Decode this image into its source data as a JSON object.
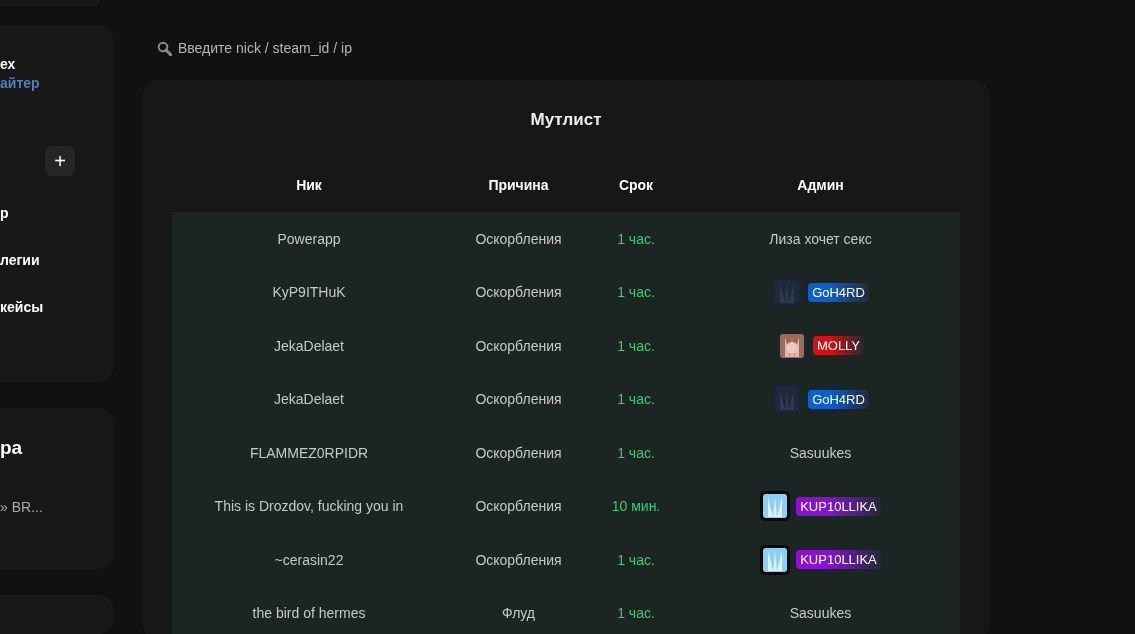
{
  "sidebar": {
    "profile_card": {
      "line_1": "ех",
      "line_2": "айтер",
      "add_button": "+",
      "menu": [
        "р",
        "легии",
        "кейсы"
      ]
    },
    "second_card": {
      "title": "ра",
      "line": "» BR..."
    }
  },
  "search": {
    "placeholder": "Введите nick / steam_id / ip"
  },
  "mutelist": {
    "title": "Мутлист",
    "columns": [
      "Ник",
      "Причина",
      "Срок",
      "Админ"
    ],
    "rows": [
      {
        "nick": "Powerapp",
        "reason": "Оскорбления",
        "term": "1 час.",
        "admin": {
          "kind": "text",
          "name": "Лиза хочет секс"
        }
      },
      {
        "nick": "KyP9ITHuK",
        "reason": "Оскорбления",
        "term": "1 час.",
        "admin": {
          "kind": "badge",
          "name": "GoH4RD",
          "color": "#0a5fd0"
        }
      },
      {
        "nick": "JekaDelaet",
        "reason": "Оскорбления",
        "term": "1 час.",
        "admin": {
          "kind": "badge",
          "name": "MOLLY",
          "color": "#d41010"
        }
      },
      {
        "nick": "JekaDelaet",
        "reason": "Оскорбления",
        "term": "1 час.",
        "admin": {
          "kind": "badge",
          "name": "GoH4RD",
          "color": "#0a5fd0"
        }
      },
      {
        "nick": "FLAMMEZ0RPIDR",
        "reason": "Оскорбления",
        "term": "1 час.",
        "admin": {
          "kind": "text",
          "name": "Sasuukes"
        }
      },
      {
        "nick": "This is Drozdov, fucking you in",
        "reason": "Оскорбления",
        "term": "10 мин.",
        "admin": {
          "kind": "badge",
          "name": "KUP10LLIKA",
          "color": "#8a10d8"
        }
      },
      {
        "nick": "~cerasin22",
        "reason": "Оскорбления",
        "term": "1 час.",
        "admin": {
          "kind": "badge",
          "name": "KUP10LLIKA",
          "color": "#8a10d8"
        }
      },
      {
        "nick": "the bird of hermes",
        "reason": "Флуд",
        "term": "1 час.",
        "admin": {
          "kind": "text",
          "name": "Sasuukes"
        }
      }
    ]
  }
}
